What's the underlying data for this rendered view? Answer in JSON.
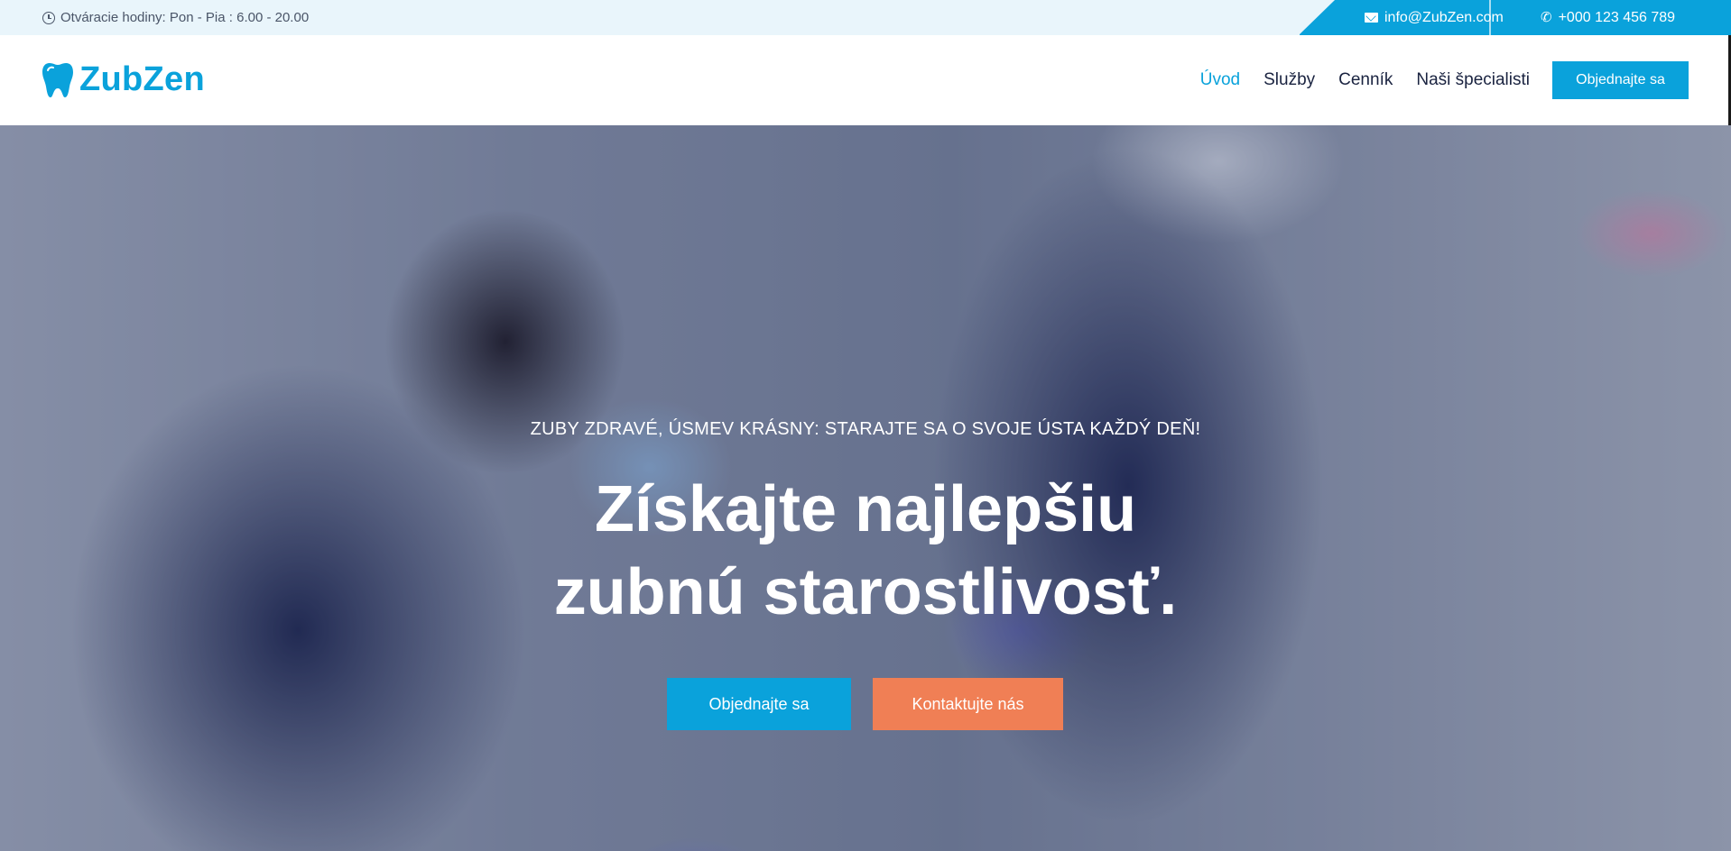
{
  "topbar": {
    "hours": "Otváracie hodiny: Pon - Pia : 6.00 - 20.00",
    "email": "info@ZubZen.com",
    "phone": "+000 123 456 789"
  },
  "header": {
    "logo_text": "ZubZen",
    "nav": [
      {
        "label": "Úvod",
        "active": true
      },
      {
        "label": "Služby",
        "active": false
      },
      {
        "label": "Cenník",
        "active": false
      },
      {
        "label": "Naši špecialisti",
        "active": false
      }
    ],
    "cta_label": "Objednajte sa"
  },
  "hero": {
    "eyebrow": "ZUBY ZDRAVÉ, ÚSMEV KRÁSNY: STARAJTE SA O SVOJE ÚSTA KAŽDÝ DEŇ!",
    "headline_line1": "Získajte najlepšiu",
    "headline_line2": "zubnú starostlivosť.",
    "primary_button": "Objednajte sa",
    "secondary_button": "Kontaktujte nás"
  },
  "colors": {
    "accent": "#0aa2db",
    "secondary": "#f07f55",
    "topbar_bg": "#e9f5fb",
    "text_dark": "#1a2340"
  },
  "icons": {
    "hours": "clock-icon",
    "email": "envelope-icon",
    "phone": "phone-icon",
    "logo": "tooth-icon"
  }
}
